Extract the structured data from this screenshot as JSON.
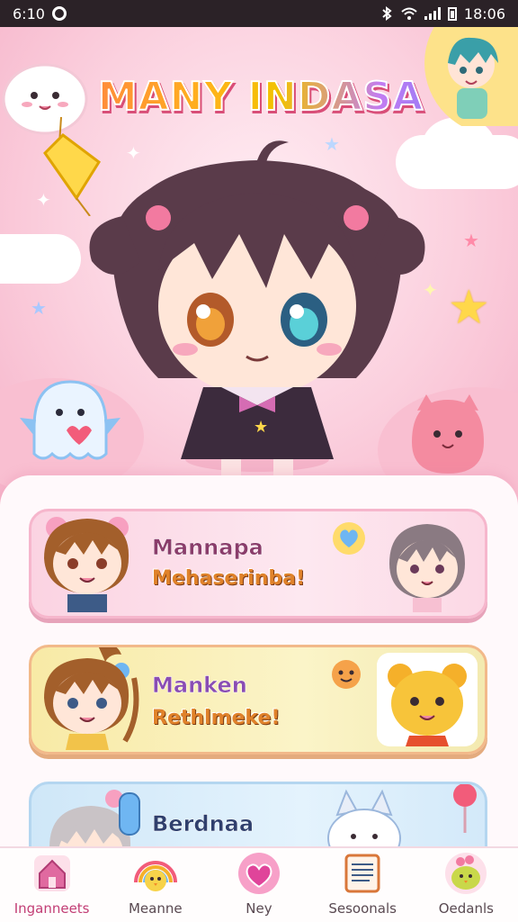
{
  "status_bar": {
    "left_text": "6:10",
    "time": "18:06",
    "icons": [
      "record-icon",
      "bluetooth-icon",
      "wifi-icon",
      "signal-icon",
      "battery-icon"
    ]
  },
  "hero": {
    "title": "MANY INDASA"
  },
  "cards": [
    {
      "line1": "Mannapa",
      "line2": "Mehaserinba!",
      "accent": "#f6b6cc"
    },
    {
      "line1": "Manken",
      "line2": "Rethlmeke!",
      "accent": "#f2b98a"
    },
    {
      "line1": "Berdnaa",
      "line2": "",
      "accent": "#b4d6f0"
    }
  ],
  "bottom_nav": [
    {
      "label": "Inganneets",
      "icon": "home-icon",
      "active": true
    },
    {
      "label": "Meanne",
      "icon": "rainbow-chick-icon",
      "active": false
    },
    {
      "label": "Ney",
      "icon": "heart-icon",
      "active": false
    },
    {
      "label": "Sesoonals",
      "icon": "list-icon",
      "active": false
    },
    {
      "label": "Oedanls",
      "icon": "bird-icon",
      "active": false
    }
  ],
  "colors": {
    "brand_pink": "#f6b3c9",
    "title_orange": "#ff8a3d",
    "title_purple": "#9b7cf6",
    "active_nav": "#c23e75"
  }
}
